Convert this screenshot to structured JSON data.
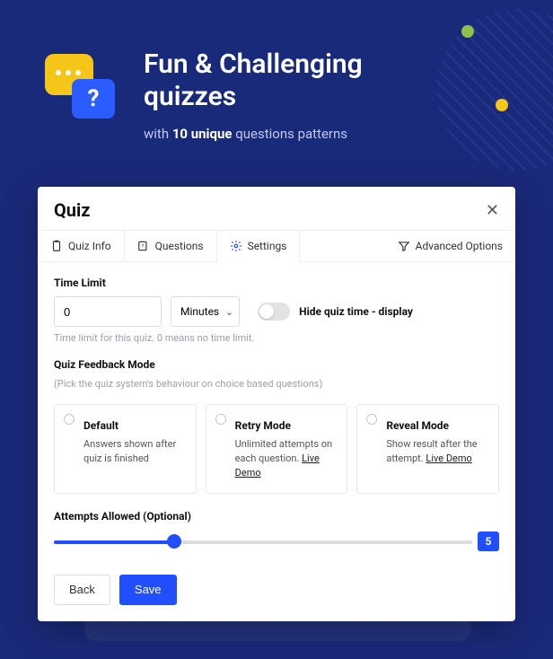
{
  "hero": {
    "title_l1": "Fun & Challenging",
    "title_l2": "quizzes",
    "subtitle_pre": "with ",
    "subtitle_bold": "10 unique",
    "subtitle_post": " questions patterns",
    "icon_question": "?"
  },
  "panel": {
    "title": "Quiz",
    "tabs": {
      "info": "Quiz Info",
      "questions": "Questions",
      "settings": "Settings",
      "advanced": "Advanced Options"
    },
    "timelimit": {
      "label": "Time Limit",
      "value": "0",
      "unit": "Minutes",
      "toggle_label": "Hide quiz time - display",
      "hint": "Time limit for this quiz. 0 means no time limit."
    },
    "feedback": {
      "label": "Quiz Feedback Mode",
      "hint": "(Pick the quiz system's behaviour on choice based questions)",
      "options": [
        {
          "title": "Default",
          "desc": "Answers shown after quiz is finished",
          "link": ""
        },
        {
          "title": "Retry Mode",
          "desc": "Unlimited attempts on each question. ",
          "link": "Live Demo"
        },
        {
          "title": "Reveal Mode",
          "desc": "Show result after the attempt. ",
          "link": "Live Demo"
        }
      ]
    },
    "attempts": {
      "label": "Attempts Allowed (Optional)",
      "value": "5"
    },
    "buttons": {
      "back": "Back",
      "save": "Save"
    }
  }
}
